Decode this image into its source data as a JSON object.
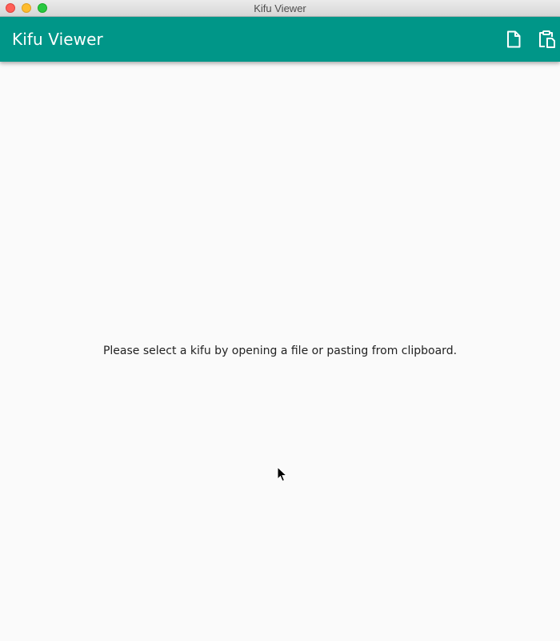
{
  "window": {
    "title": "Kifu Viewer"
  },
  "appbar": {
    "title": "Kifu Viewer",
    "color": "#009688",
    "actions": [
      {
        "icon": "file-icon",
        "label": "Open file"
      },
      {
        "icon": "clipboard-icon",
        "label": "Paste from clipboard"
      }
    ]
  },
  "main": {
    "empty_message": "Please select a kifu by opening a file or pasting from clipboard."
  }
}
